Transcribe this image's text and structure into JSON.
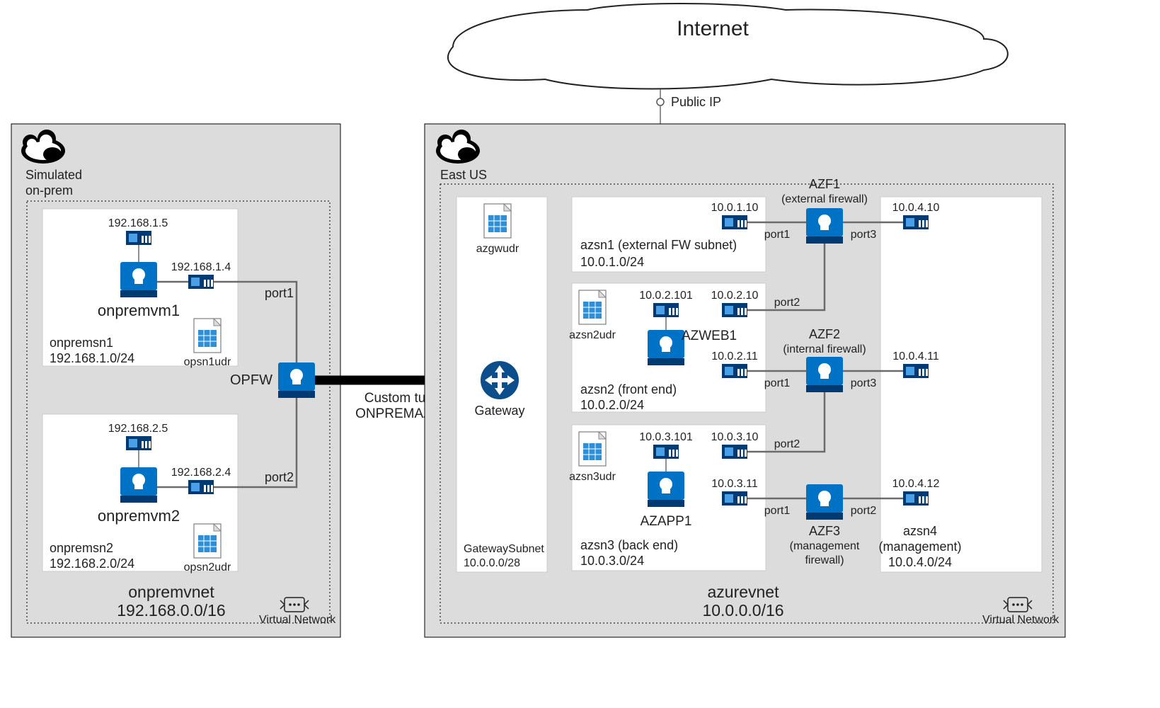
{
  "title": "Internet",
  "public_ip_label": "Public IP",
  "left_region": {
    "label1": "Simulated",
    "label2": "on-prem",
    "vnet_name": "onpremvnet",
    "vnet_cidr": "192.168.0.0/16",
    "vnet_badge": "Virtual Network",
    "sn1": {
      "name": "onpremsn1",
      "cidr": "192.168.1.0/24",
      "vm": "onpremvm1",
      "nicA": "192.168.1.5",
      "nicB": "192.168.1.4",
      "udr": "opsn1udr"
    },
    "sn2": {
      "name": "onpremsn2",
      "cidr": "192.168.2.0/24",
      "vm": "onpremvm2",
      "nicA": "192.168.2.5",
      "nicB": "192.168.2.4",
      "udr": "opsn2udr"
    },
    "fw": {
      "name": "OPFW",
      "port1": "port1",
      "port2": "port2"
    }
  },
  "tunnel": {
    "l1": "Custom tunnel",
    "l2": "ONPREMAZURE"
  },
  "gateway_label": "Gateway",
  "right_region": {
    "label": "East US",
    "vnet_name": "azurevnet",
    "vnet_cidr": "10.0.0.0/16",
    "vnet_badge": "Virtual Network",
    "gw_sub": {
      "name": "GatewaySubnet",
      "cidr": "10.0.0.0/28",
      "udr": "azgwudr"
    },
    "sn1": {
      "title": "azsn1 (external FW subnet)",
      "cidr": "10.0.1.0/24",
      "nic": "10.0.1.10",
      "port": "port1"
    },
    "sn2": {
      "title": "azsn2 (front end)",
      "cidr": "10.0.2.0/24",
      "udr": "azsn2udr",
      "vm": "AZWEB1",
      "nicA": "10.0.2.101",
      "nicB": "10.0.2.10",
      "nicC": "10.0.2.11",
      "portB": "port1"
    },
    "sn3": {
      "title": "azsn3 (back end)",
      "cidr": "10.0.3.0/24",
      "udr": "azsn3udr",
      "vm": "AZAPP1",
      "nicA": "10.0.3.101",
      "nicB": "10.0.3.10",
      "nicC": "10.0.3.11",
      "portB": "port1"
    },
    "sn4": {
      "title": "azsn4",
      "sub": "(management)",
      "cidr": "10.0.4.0/24",
      "nic1": "10.0.4.10",
      "nic2": "10.0.4.11",
      "nic3": "10.0.4.12",
      "port": "port3",
      "port2": "port3",
      "port3": "port2"
    },
    "fw1": {
      "name": "AZF1",
      "sub": "(external firewall)",
      "port2": "port2"
    },
    "fw2": {
      "name": "AZF2",
      "sub": "(internal firewall)",
      "port2": "port2"
    },
    "fw3": {
      "name": "AZF3",
      "sub": [
        "(management",
        "firewall)"
      ]
    }
  }
}
